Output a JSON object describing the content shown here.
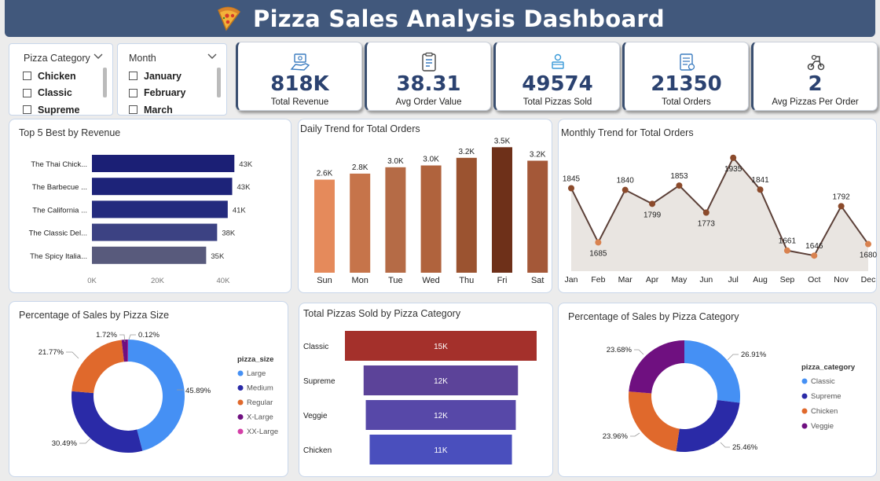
{
  "header": {
    "title": "Pizza Sales Analysis Dashboard",
    "icon": "pizza-icon"
  },
  "slicers": {
    "category": {
      "title": "Pizza Category",
      "items": [
        "Chicken",
        "Classic",
        "Supreme"
      ]
    },
    "month": {
      "title": "Month",
      "items": [
        "January",
        "February",
        "March"
      ]
    }
  },
  "kpis": [
    {
      "value": "818K",
      "label": "Total Revenue",
      "icon": "money-hand-icon"
    },
    {
      "value": "38.31",
      "label": "Avg Order Value",
      "icon": "receipt-icon"
    },
    {
      "value": "49574",
      "label": "Total Pizzas Sold",
      "icon": "delivery-icon"
    },
    {
      "value": "21350",
      "label": "Total Orders",
      "icon": "order-list-icon"
    },
    {
      "value": "2",
      "label": "Avg Pizzas Per Order",
      "icon": "scooter-icon"
    }
  ],
  "colors": {
    "header": "#41587c",
    "kpi_value": "#2b4270"
  },
  "chart_data": [
    {
      "type": "bar",
      "orientation": "horizontal",
      "title": "Top 5 Best by Revenue",
      "categories": [
        "The Thai Chick...",
        "The Barbecue ...",
        "The California ...",
        "The Classic Del...",
        "The Spicy Italia..."
      ],
      "values": [
        43434,
        42768,
        41410,
        38180,
        34831
      ],
      "labels": [
        "43K",
        "43K",
        "41K",
        "38K",
        "35K"
      ],
      "colors": [
        "#1b1f75",
        "#1d2379",
        "#242b7e",
        "#3c4283",
        "#585a7c"
      ],
      "xticks": [
        "0K",
        "20K",
        "40K"
      ],
      "xlim": [
        0,
        46000
      ]
    },
    {
      "type": "bar",
      "title": "Daily Trend for Total Orders",
      "categories": [
        "Sun",
        "Mon",
        "Tue",
        "Wed",
        "Thu",
        "Fri",
        "Sat"
      ],
      "values": [
        2624,
        2794,
        2973,
        3024,
        3239,
        3538,
        3158
      ],
      "labels": [
        "2.6K",
        "2.8K",
        "3.0K",
        "3.0K",
        "3.2K",
        "3.5K",
        "3.2K"
      ],
      "colors": [
        "#e58a5b",
        "#c6744a",
        "#b56b46",
        "#b0633d",
        "#9b5330",
        "#6e3019",
        "#a45838"
      ],
      "ylim": [
        0,
        3700
      ]
    },
    {
      "type": "area",
      "title": "Monthly Trend for Total Orders",
      "categories": [
        "Jan",
        "Feb",
        "Mar",
        "Apr",
        "May",
        "Jun",
        "Jul",
        "Aug",
        "Sep",
        "Oct",
        "Nov",
        "Dec"
      ],
      "values": [
        1845,
        1685,
        1840,
        1799,
        1853,
        1773,
        1935,
        1841,
        1661,
        1646,
        1792,
        1680
      ],
      "labels": [
        "1845",
        "1685",
        "1840",
        "1799",
        "1853",
        "1773",
        "1935",
        "1841",
        "1661",
        "1646",
        "1792",
        "1680"
      ],
      "label_pos": [
        "above",
        "below",
        "above",
        "below",
        "above",
        "below",
        "below",
        "above",
        "above",
        "above",
        "above",
        "below"
      ],
      "ylim": [
        1600,
        1960
      ]
    },
    {
      "type": "pie",
      "donut": true,
      "title": "Percentage of Sales by Pizza Size",
      "legend_title": "pizza_size",
      "legend_position": "right",
      "categories": [
        "Large",
        "Medium",
        "Regular",
        "X-Large",
        "XX-Large"
      ],
      "values": [
        45.89,
        30.49,
        21.77,
        1.72,
        0.12
      ],
      "labels": [
        "45.89%",
        "30.49%",
        "21.77%",
        "1.72%",
        "0.12%"
      ],
      "colors": [
        "#4590f4",
        "#2a2aa7",
        "#e0692c",
        "#6f1080",
        "#d43fa7"
      ]
    },
    {
      "type": "bar",
      "subtype": "funnel",
      "title": "Total Pizzas Sold by Pizza Category",
      "categories": [
        "Classic",
        "Supreme",
        "Veggie",
        "Chicken"
      ],
      "values": [
        14888,
        11987,
        11649,
        11050
      ],
      "labels": [
        "15K",
        "12K",
        "12K",
        "11K"
      ],
      "colors": [
        "#a4302b",
        "#5c4399",
        "#5748a8",
        "#4a4fbd"
      ]
    },
    {
      "type": "pie",
      "donut": true,
      "title": "Percentage of Sales by Pizza Category",
      "legend_title": "pizza_category",
      "legend_position": "right",
      "categories": [
        "Classic",
        "Supreme",
        "Chicken",
        "Veggie"
      ],
      "values": [
        26.91,
        25.46,
        23.96,
        23.68
      ],
      "labels": [
        "26.91%",
        "25.46%",
        "23.96%",
        "23.68%"
      ],
      "colors": [
        "#4590f4",
        "#2a2aa7",
        "#e0692c",
        "#6f1080"
      ]
    }
  ]
}
